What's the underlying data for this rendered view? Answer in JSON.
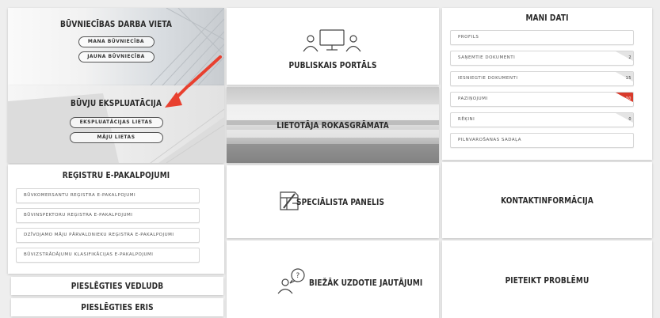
{
  "colors": {
    "accent_red": "#d93a2b",
    "arrow_red": "#e8402f",
    "tile_bg": "#ffffff",
    "page_bg": "#eeeeee"
  },
  "buvniecibas": {
    "title": "BŪVNIECĪBAS DARBA VIETA",
    "buttons": [
      "MANA BŪVNIECĪBA",
      "JAUNA BŪVNIECĪBA"
    ]
  },
  "ekspluatacija": {
    "title": "BŪVJU EKSPLUATĀCIJA",
    "buttons": [
      "EKSPLUATĀCIJAS LIETAS",
      "MĀJU LIETAS"
    ]
  },
  "registri": {
    "title": "REĢISTRU E-PAKALPOJUMI",
    "items": [
      "BŪVKOMERSANTU REĢISTRA E-PAKALPOJUMI",
      "BŪVINSPEKTORU REĢISTRA E-PAKALPOJUMI",
      "DZĪVOJAMO MĀJU PĀRVALDNIEKU REĢISTRA E-PAKALPOJUMI",
      "BŪVIZSTRĀDĀJUMU KLASIFIKĀCIJAS E-PAKALPOJUMI"
    ]
  },
  "pieslegties_vedludb": {
    "label": "PIESLĒGTIES VEDLUDB"
  },
  "pieslegties_eris": {
    "label": "PIESLĒGTIES ERIS"
  },
  "publiskais": {
    "title": "PUBLISKAIS PORTĀLS",
    "icon": "people-computer-icon"
  },
  "rokasgramata": {
    "title": "LIETOTĀJA ROKASGRĀMATA"
  },
  "specialista": {
    "title": "SPECIĀLISTA PANELIS",
    "icon": "blueprint-pencil-icon"
  },
  "jautajumi": {
    "title": "BIEŽĀK UZDOTIE JAUTĀJUMI",
    "icon": "person-question-icon"
  },
  "mani_dati": {
    "title": "MANI DATI",
    "items": [
      {
        "label": "PROFILS",
        "badge": ""
      },
      {
        "label": "SAŅEMTIE DOKUMENTI",
        "badge": "2"
      },
      {
        "label": "IESNIEGTIE DOKUMENTI",
        "badge": "15"
      },
      {
        "label": "PAZIŅOJUMI",
        "badge": "30"
      },
      {
        "label": "RĒĶINI",
        "badge": "0"
      },
      {
        "label": "PILNVAROŠANAS SADAĻA",
        "badge": ""
      }
    ]
  },
  "kontaktinformacija": {
    "title": "KONTAKTINFORMĀCIJA"
  },
  "pieteikt": {
    "title": "PIETEIKT PROBLĒMU"
  }
}
